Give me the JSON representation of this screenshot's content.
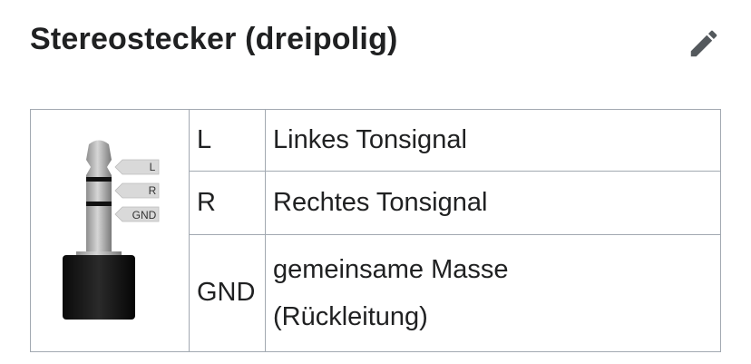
{
  "header": {
    "title": "Stereostecker (dreipolig)"
  },
  "icons": {
    "edit": "pencil-icon"
  },
  "plug_image": {
    "labels": [
      "L",
      "R",
      "GND"
    ]
  },
  "table": {
    "rows": [
      {
        "pin": "L",
        "description": "Linkes Tonsignal"
      },
      {
        "pin": "R",
        "description": "Rechtes Tonsignal"
      },
      {
        "pin": "GND",
        "description_line1": "gemeinsame Masse",
        "description_line2": "(Rückleitung)"
      }
    ]
  },
  "colors": {
    "text": "#202122",
    "border": "#a2a9b1",
    "icon": "#54595d"
  }
}
